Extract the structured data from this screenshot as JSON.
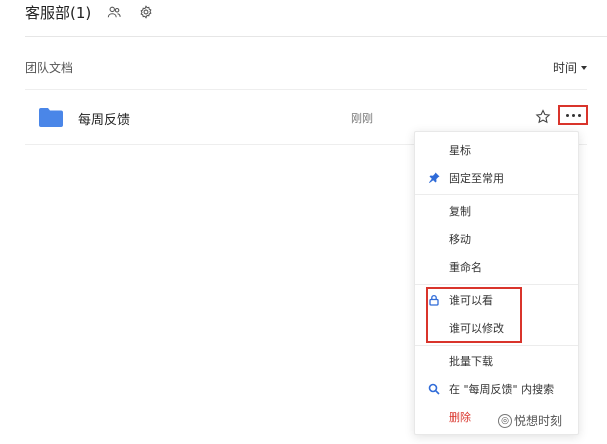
{
  "header": {
    "title": "客服部(1)"
  },
  "section": {
    "label": "团队文档",
    "sort_label": "时间"
  },
  "row": {
    "name": "每周反馈",
    "time": "刚刚"
  },
  "menu": {
    "items": [
      {
        "label": "星标"
      },
      {
        "label": "固定至常用"
      },
      {
        "label": "复制"
      },
      {
        "label": "移动"
      },
      {
        "label": "重命名"
      },
      {
        "label": "谁可以看"
      },
      {
        "label": "谁可以修改"
      },
      {
        "label": "批量下载"
      },
      {
        "label": "在 \"每周反馈\" 内搜索"
      },
      {
        "label": "删除"
      }
    ]
  },
  "watermark": {
    "text": "悦想时刻"
  },
  "colors": {
    "folder": "#4a86e8",
    "accent_blue": "#2f6bd8",
    "danger": "#d9342b",
    "highlight_box": "#d9342b"
  },
  "icons": [
    "members-icon",
    "settings-icon",
    "folder-icon",
    "star-icon",
    "more-icon",
    "pin-icon",
    "lock-icon",
    "search-icon"
  ]
}
